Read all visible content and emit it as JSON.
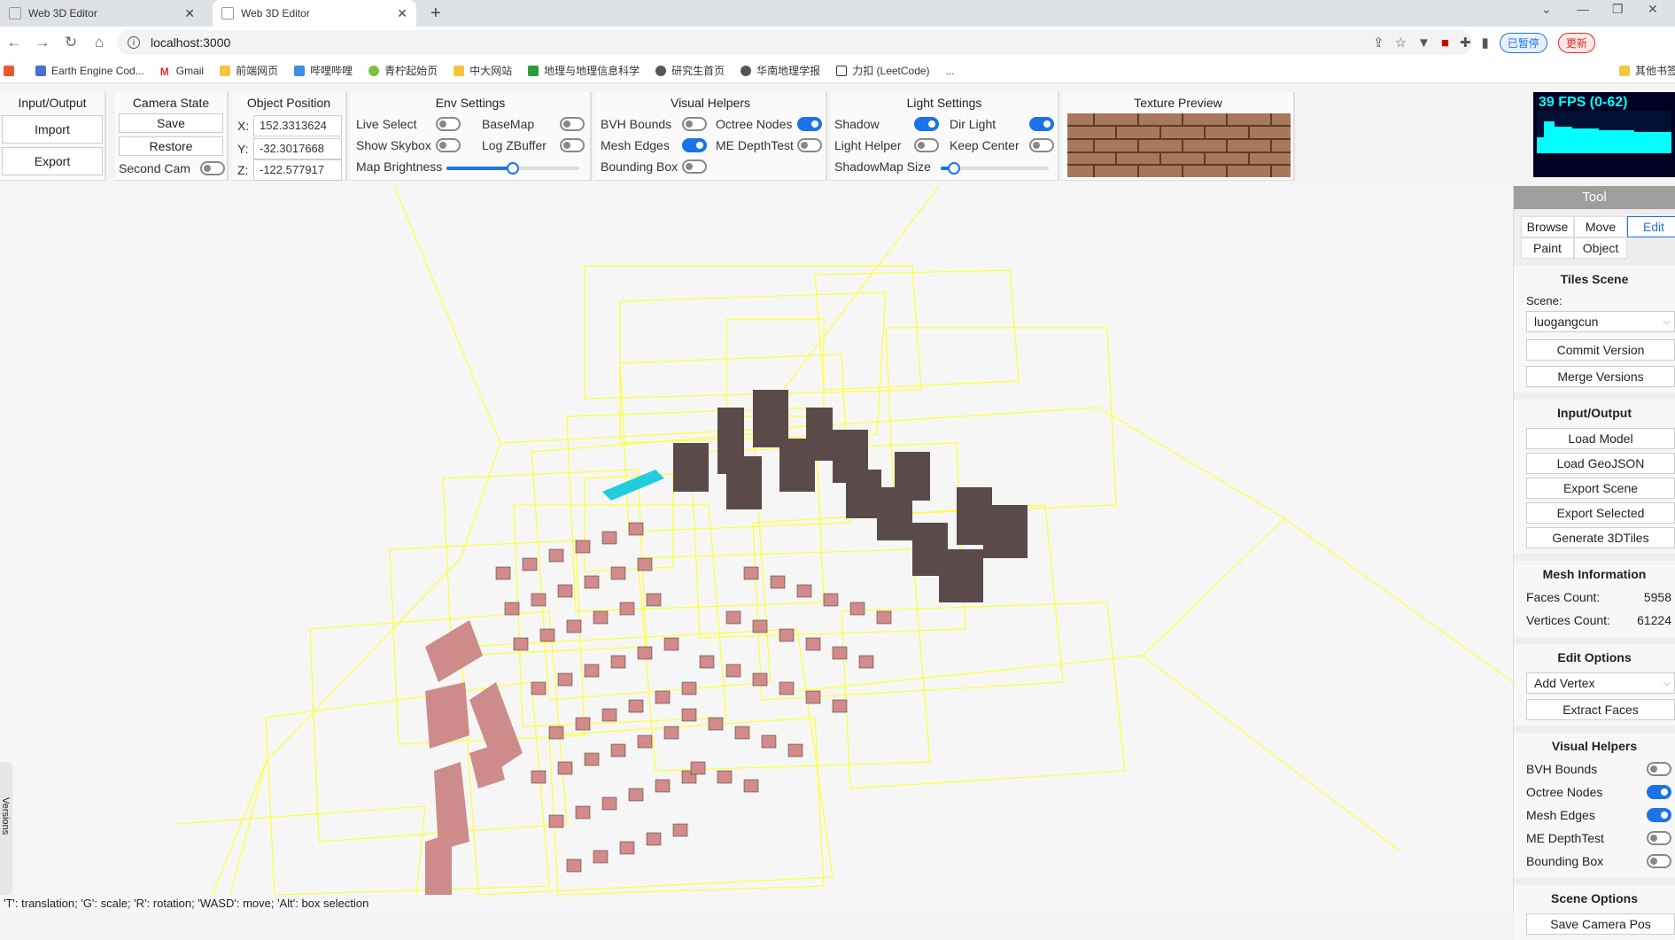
{
  "browser": {
    "tabs": [
      {
        "title": "Web 3D Editor",
        "active": false
      },
      {
        "title": "Web 3D Editor",
        "active": true
      }
    ],
    "url": "localhost:3000",
    "profile_label": "已暂停",
    "update_label": "更新",
    "bookmarks": [
      "Earth Engine Cod...",
      "Gmail",
      "前端网页",
      "哔哩哔哩",
      "青柠起始页",
      "中大网站",
      "地理与地理信息科学",
      "研究生首页",
      "华南地理学报",
      "力扣 (LeetCode)",
      "..."
    ],
    "other_bookmarks": "其他书签"
  },
  "top": {
    "io": {
      "title": "Input/Output",
      "import": "Import",
      "export": "Export"
    },
    "camera": {
      "title": "Camera State",
      "save": "Save",
      "restore": "Restore",
      "second_cam": "Second Cam"
    },
    "object_position": {
      "title": "Object Position",
      "x_label": "X:",
      "x": "152.3313624",
      "y_label": "Y:",
      "y": "-32.3017668",
      "z_label": "Z:",
      "z": "-122.577917"
    },
    "env": {
      "title": "Env Settings",
      "live_select": "Live Select",
      "basemap": "BaseMap",
      "show_skybox": "Show Skybox",
      "log_zbuffer": "Log ZBuffer",
      "map_brightness": "Map Brightness",
      "map_brightness_value": 0.5
    },
    "visual": {
      "title": "Visual Helpers",
      "bvh_bounds": "BVH Bounds",
      "octree_nodes": "Octree Nodes",
      "mesh_edges": "Mesh Edges",
      "me_depthtest": "ME DepthTest",
      "bounding_box": "Bounding Box"
    },
    "light": {
      "title": "Light Settings",
      "shadow": "Shadow",
      "dir_light": "Dir Light",
      "light_helper": "Light Helper",
      "keep_center": "Keep Center",
      "shadowmap_size": "ShadowMap Size",
      "shadowmap_value": 0.12
    },
    "texture": {
      "title": "Texture Preview"
    }
  },
  "fps": {
    "text": "39 FPS (0-62)"
  },
  "status": "'T': translation; 'G': scale; 'R': rotation; 'WASD': move; 'Alt': box selection",
  "versions_label": "Versions",
  "right": {
    "header": "Tool",
    "modes": [
      "Browse",
      "Move",
      "Edit",
      "Paint",
      "Object"
    ],
    "tiles": {
      "title": "Tiles Scene",
      "scene_label": "Scene:",
      "scene_value": "luogangcun",
      "commit": "Commit Version",
      "merge": "Merge Versions"
    },
    "io": {
      "title": "Input/Output",
      "load_model": "Load Model",
      "load_geojson": "Load GeoJSON",
      "export_scene": "Export Scene",
      "export_selected": "Export Selected",
      "generate": "Generate 3DTiles"
    },
    "mesh": {
      "title": "Mesh Information",
      "faces_label": "Faces Count:",
      "faces": "5958",
      "verts_label": "Vertices Count:",
      "verts": "61224"
    },
    "edit": {
      "title": "Edit Options",
      "mode": "Add Vertex",
      "extract": "Extract Faces"
    },
    "visual": {
      "title": "Visual Helpers",
      "bvh": "BVH Bounds",
      "octree": "Octree Nodes",
      "mesh_edges": "Mesh Edges",
      "me_depth": "ME DepthTest",
      "bbox": "Bounding Box"
    },
    "scene_opts": {
      "title": "Scene Options",
      "save_cam": "Save Camera Pos"
    }
  }
}
